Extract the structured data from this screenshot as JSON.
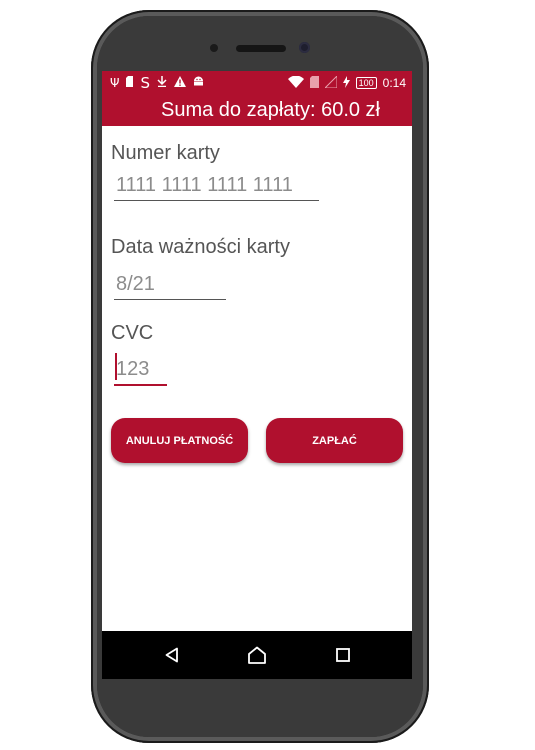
{
  "status_bar": {
    "left_icons": [
      "usb-icon",
      "sim-icon",
      "s-app-icon",
      "download-icon",
      "warning-icon",
      "android-icon"
    ],
    "battery_level": "100",
    "time": "0:14"
  },
  "app_bar": {
    "title": "Suma do zapłaty: 60.0 zł"
  },
  "form": {
    "card_number": {
      "label": "Numer karty",
      "placeholder": "1111 1111 1111 1111",
      "value": ""
    },
    "expiry": {
      "label": "Data ważności karty",
      "placeholder": "8/21",
      "value": ""
    },
    "cvc": {
      "label": "CVC",
      "placeholder": "123",
      "value": ""
    }
  },
  "buttons": {
    "cancel_label": "ANULUJ PŁATNOŚĆ",
    "pay_label": "ZAPŁAĆ"
  },
  "nav_bar": {
    "buttons": [
      "back-icon",
      "home-icon",
      "recents-icon"
    ]
  },
  "colors": {
    "accent": "#b0102e",
    "nav_background": "#000000",
    "phone_body": "#2f2f2f"
  }
}
